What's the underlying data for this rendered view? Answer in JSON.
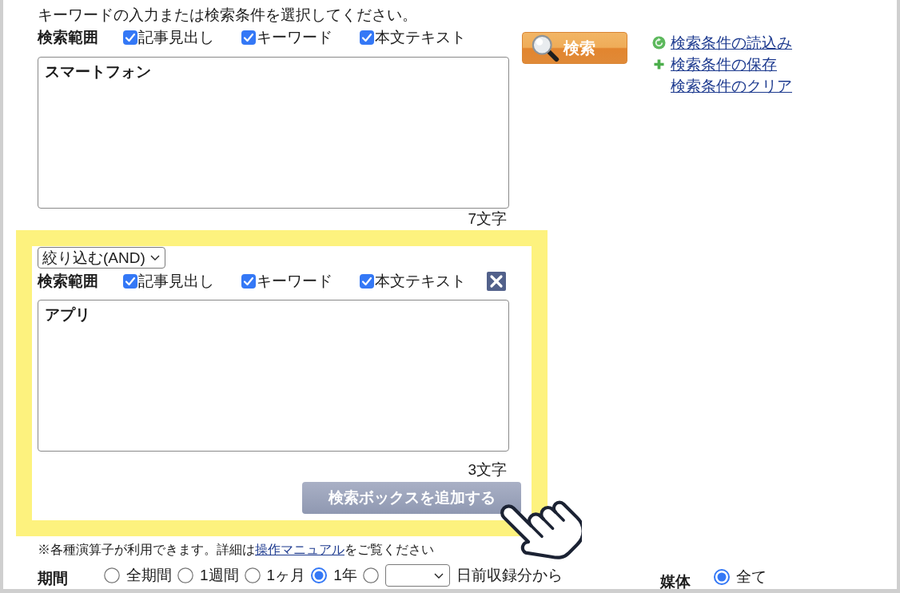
{
  "instruction": "キーワードの入力または検索条件を選択してください。",
  "search_boxes": [
    {
      "highlighted": false,
      "removable": false,
      "scope_label": "検索範囲",
      "scopes": [
        {
          "label": "記事見出し",
          "checked": true
        },
        {
          "label": "キーワード",
          "checked": true
        },
        {
          "label": "本文テキスト",
          "checked": true
        }
      ],
      "text": "スマートフォン",
      "char_count": "7文字"
    },
    {
      "highlighted": true,
      "removable": true,
      "operator": "絞り込む(AND)",
      "scope_label": "検索範囲",
      "scopes": [
        {
          "label": "記事見出し",
          "checked": true
        },
        {
          "label": "キーワード",
          "checked": true
        },
        {
          "label": "本文テキスト",
          "checked": true
        }
      ],
      "text": "アプリ",
      "char_count": "3文字"
    }
  ],
  "add_box_button": {
    "label": "検索ボックスを追加する"
  },
  "search_button": {
    "label": "検索"
  },
  "condition_links": [
    {
      "kind": "load",
      "label": "検索条件の読込み"
    },
    {
      "kind": "save",
      "label": "検索条件の保存"
    },
    {
      "kind": "clear",
      "label": "検索条件のクリア"
    }
  ],
  "note": {
    "before": "※各種演算子が利用できます。詳細は",
    "link": "操作マニュアル",
    "after": "をご覧ください"
  },
  "period": {
    "label": "期間",
    "options": [
      {
        "kind": "preset",
        "label": "全期間",
        "selected": false
      },
      {
        "kind": "preset",
        "label": "1週間",
        "selected": false
      },
      {
        "kind": "preset",
        "label": "1ヶ月",
        "selected": false
      },
      {
        "kind": "preset",
        "label": "1年",
        "selected": true
      },
      {
        "kind": "days",
        "label": "日前収録分から",
        "selected": false
      }
    ]
  },
  "media": {
    "label": "媒体",
    "options": [
      {
        "label": "全て",
        "selected": true
      }
    ]
  }
}
